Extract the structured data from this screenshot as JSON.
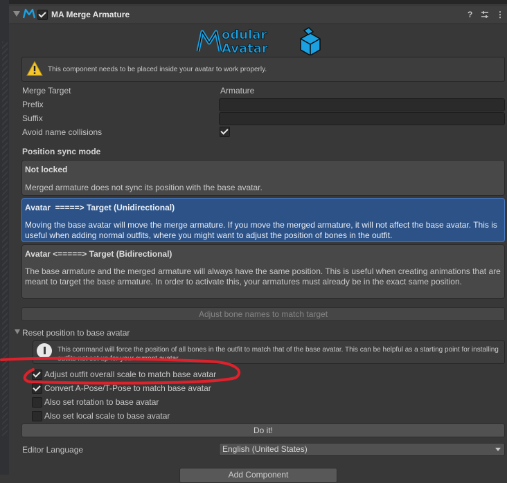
{
  "component": {
    "title": "MA Merge Armature",
    "help_icon": "help-icon",
    "preset_icon": "preset-icon",
    "menu_icon": "kebab-menu-icon"
  },
  "banner": {
    "line1": "odular",
    "line2": "Avatar",
    "brand_color": "#1ba1e2"
  },
  "warning": {
    "icon": "warning-icon",
    "text": "This component needs to be placed inside your avatar to work properly."
  },
  "fields": {
    "merge_target_label": "Merge Target",
    "merge_target_value": "Armature",
    "prefix_label": "Prefix",
    "prefix_value": "",
    "suffix_label": "Suffix",
    "suffix_value": "",
    "avoid_label": "Avoid name collisions",
    "avoid_checked": true
  },
  "sync": {
    "heading": "Position sync mode",
    "options": [
      {
        "title": "Not locked",
        "desc": "Merged armature does not sync its position with the base avatar.",
        "selected": false
      },
      {
        "title": "Avatar  =====> Target (Unidirectional)",
        "desc": "Moving the base avatar will move the merge armature. If you move the merged armature, it will not affect the base avatar. This is useful when adding normal outfits, where you might want to adjust the position of bones in the outfit.",
        "selected": true
      },
      {
        "title": "Avatar <=====> Target (Bidirectional)",
        "desc": "The base armature and the merged armature will always have the same position. This is useful when creating animations that are meant to target the base armature. In order to activate this, your armatures must already be in the exact same position.",
        "selected": false
      }
    ]
  },
  "adjust_button": "Adjust bone names to match target",
  "reset": {
    "heading": "Reset position to base avatar",
    "info": "This command will force the position of all bones in the outfit to match that of the base avatar. This can be helpful as a starting point for installing outfits not set up for your current avatar.",
    "options": [
      {
        "label": "Adjust outfit overall scale to match base avatar",
        "checked": true
      },
      {
        "label": "Convert A-Pose/T-Pose to match base avatar",
        "checked": true
      },
      {
        "label": "Also set rotation to base avatar",
        "checked": false
      },
      {
        "label": "Also set local scale to base avatar",
        "checked": false
      }
    ],
    "do_it": "Do it!"
  },
  "language": {
    "label": "Editor Language",
    "value": "English (United States)"
  },
  "add_component": "Add Component",
  "highlight_color": "#e0202a"
}
